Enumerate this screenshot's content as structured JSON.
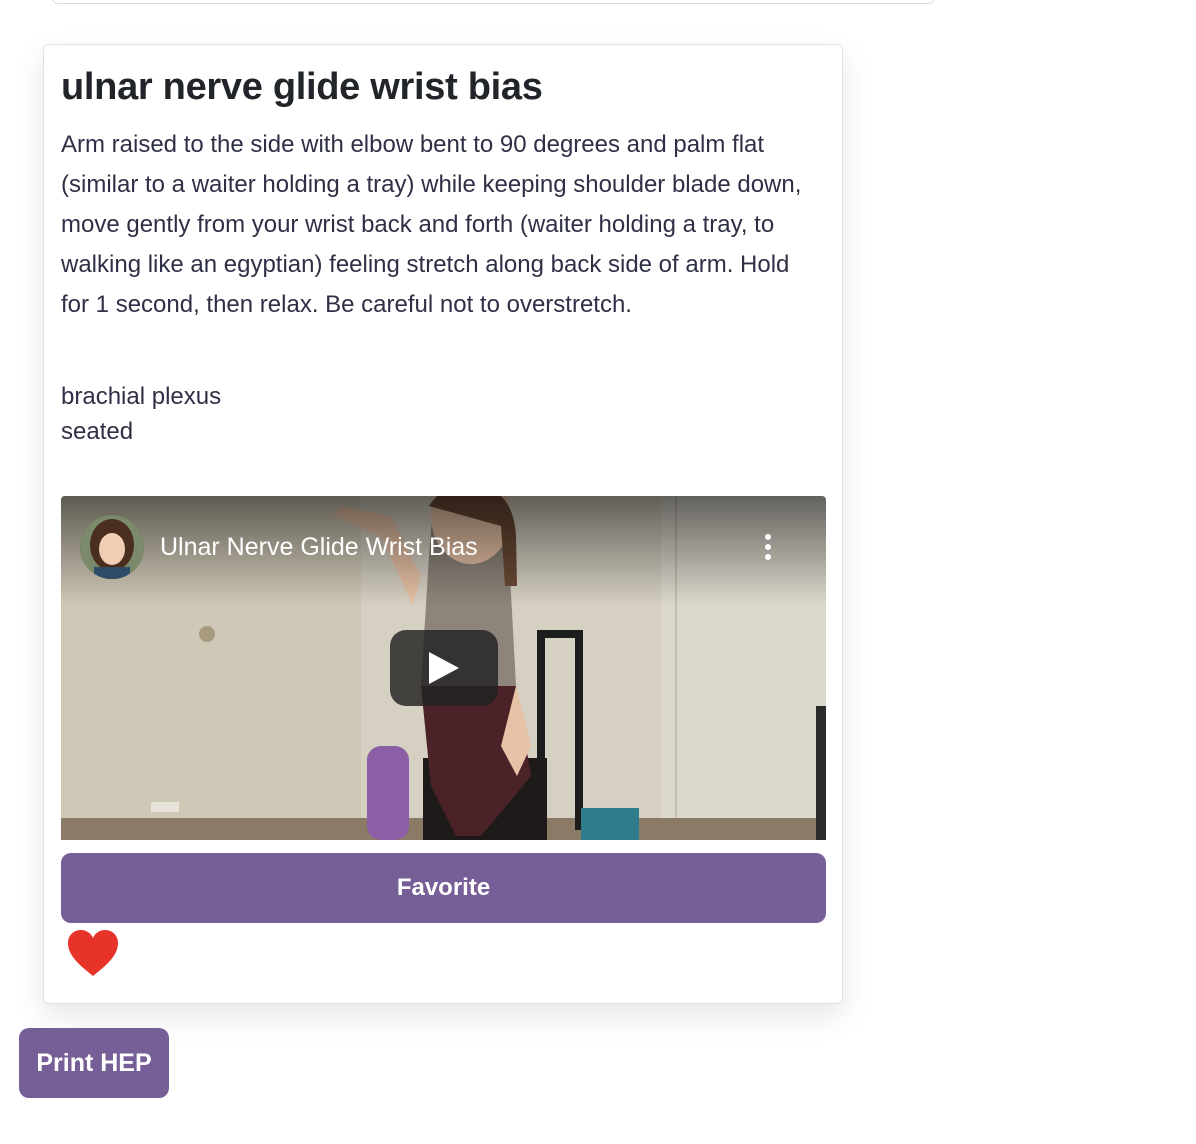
{
  "exercise": {
    "title": "ulnar nerve glide wrist bias",
    "description": "Arm raised to the side with elbow bent to 90 degrees and palm flat (similar to a waiter holding a tray) while keeping shoulder blade down, move gently from your wrist back and forth (waiter holding a tray, to walking like an egyptian) feeling stretch along back side of arm. Hold for 1 second, then relax. Be careful not to overstretch.",
    "tags": [
      "brachial plexus",
      "seated"
    ],
    "favorited": true
  },
  "video": {
    "title": "Ulnar Nerve Glide Wrist Bias",
    "icons": {
      "menu": "more-vert-icon",
      "play": "play-icon"
    }
  },
  "buttons": {
    "favorite_label": "Favorite",
    "print_label": "Print HEP"
  },
  "colors": {
    "button_bg": "#765e97",
    "heart": "#e8332a"
  }
}
